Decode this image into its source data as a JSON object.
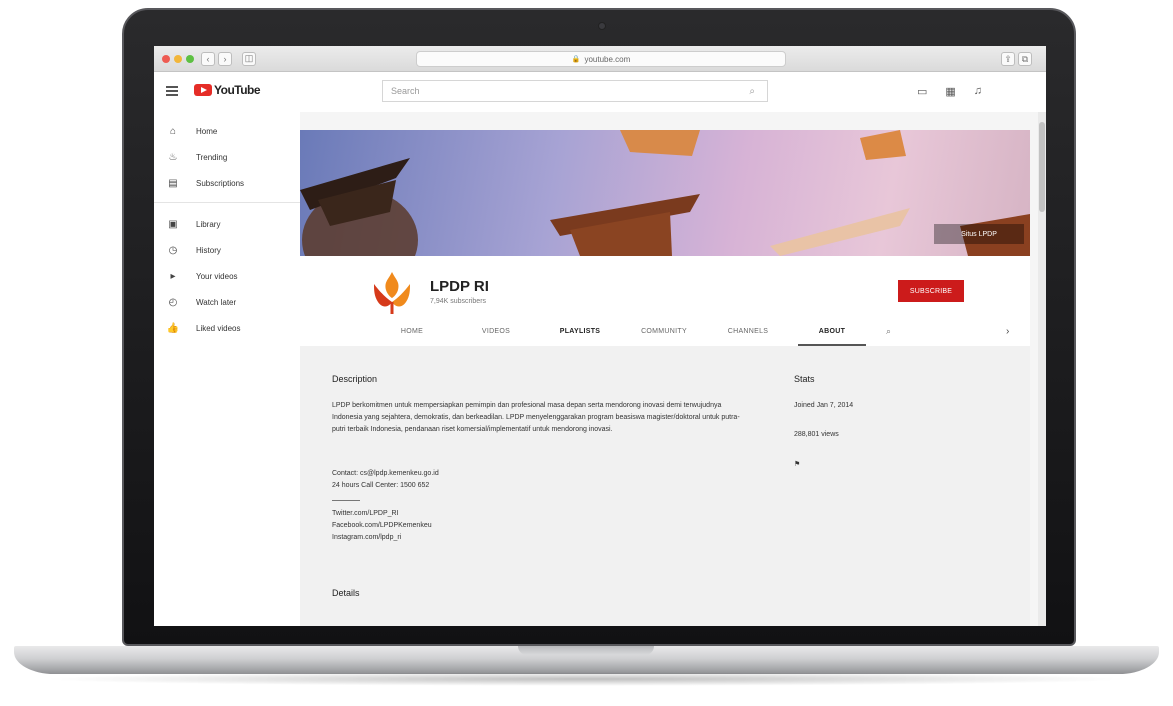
{
  "browser": {
    "url": "youtube.com",
    "back_label": "‹",
    "forward_label": "›",
    "sidebar_label": "◫",
    "share_label": "⇪",
    "tabs_label": "⧉"
  },
  "header": {
    "logo_text": "YouTube",
    "search_placeholder": "Search"
  },
  "sidebar": {
    "items": [
      {
        "label": "Home",
        "icon": "home-icon"
      },
      {
        "label": "Trending",
        "icon": "flame-icon"
      },
      {
        "label": "Subscriptions",
        "icon": "subscriptions-icon"
      },
      {
        "label": "Library",
        "icon": "library-icon"
      },
      {
        "label": "History",
        "icon": "history-icon"
      },
      {
        "label": "Your videos",
        "icon": "your-videos-icon"
      },
      {
        "label": "Watch later",
        "icon": "clock-icon"
      },
      {
        "label": "Liked videos",
        "icon": "thumbs-up-icon"
      }
    ]
  },
  "banner": {
    "link_label": "Situs LPDP"
  },
  "channel": {
    "name": "LPDP RI",
    "subscribers": "7,94K subscribers",
    "subscribe_label": "SUBSCRIBE",
    "tabs": [
      "HOME",
      "VIDEOS",
      "PLAYLISTS",
      "COMMUNITY",
      "CHANNELS",
      "ABOUT"
    ],
    "active_tab": "ABOUT"
  },
  "about": {
    "description_title": "Description",
    "description": "LPDP berkomitmen untuk mempersiapkan pemimpin dan profesional masa depan serta mendorong inovasi demi terwujudnya Indonesia yang sejahtera, demokratis, dan berkeadilan. LPDP menyelenggarakan program beasiswa magister/doktoral untuk putra-putri terbaik Indonesia, pendanaan riset komersial/implementatif untuk mendorong inovasi.",
    "contact_line1": "Contact: cs@lpdp.kemenkeu.go.id",
    "contact_line2": "24 hours Call Center: 1500 652",
    "link1": "Twitter.com/LPDP_RI",
    "link2": "Facebook.com/LPDPKemenkeu",
    "link3": "Instagram.com/lpdp_ri",
    "details_title": "Details",
    "stats_title": "Stats",
    "joined": "Joined Jan 7, 2014",
    "views": "288,801 views",
    "flag_label": "⚑"
  },
  "colors": {
    "subscribe": "#cc1b1b",
    "logo_red": "#e52d27",
    "avatar_orange": "#f08a1c",
    "avatar_red": "#d63a1a"
  }
}
